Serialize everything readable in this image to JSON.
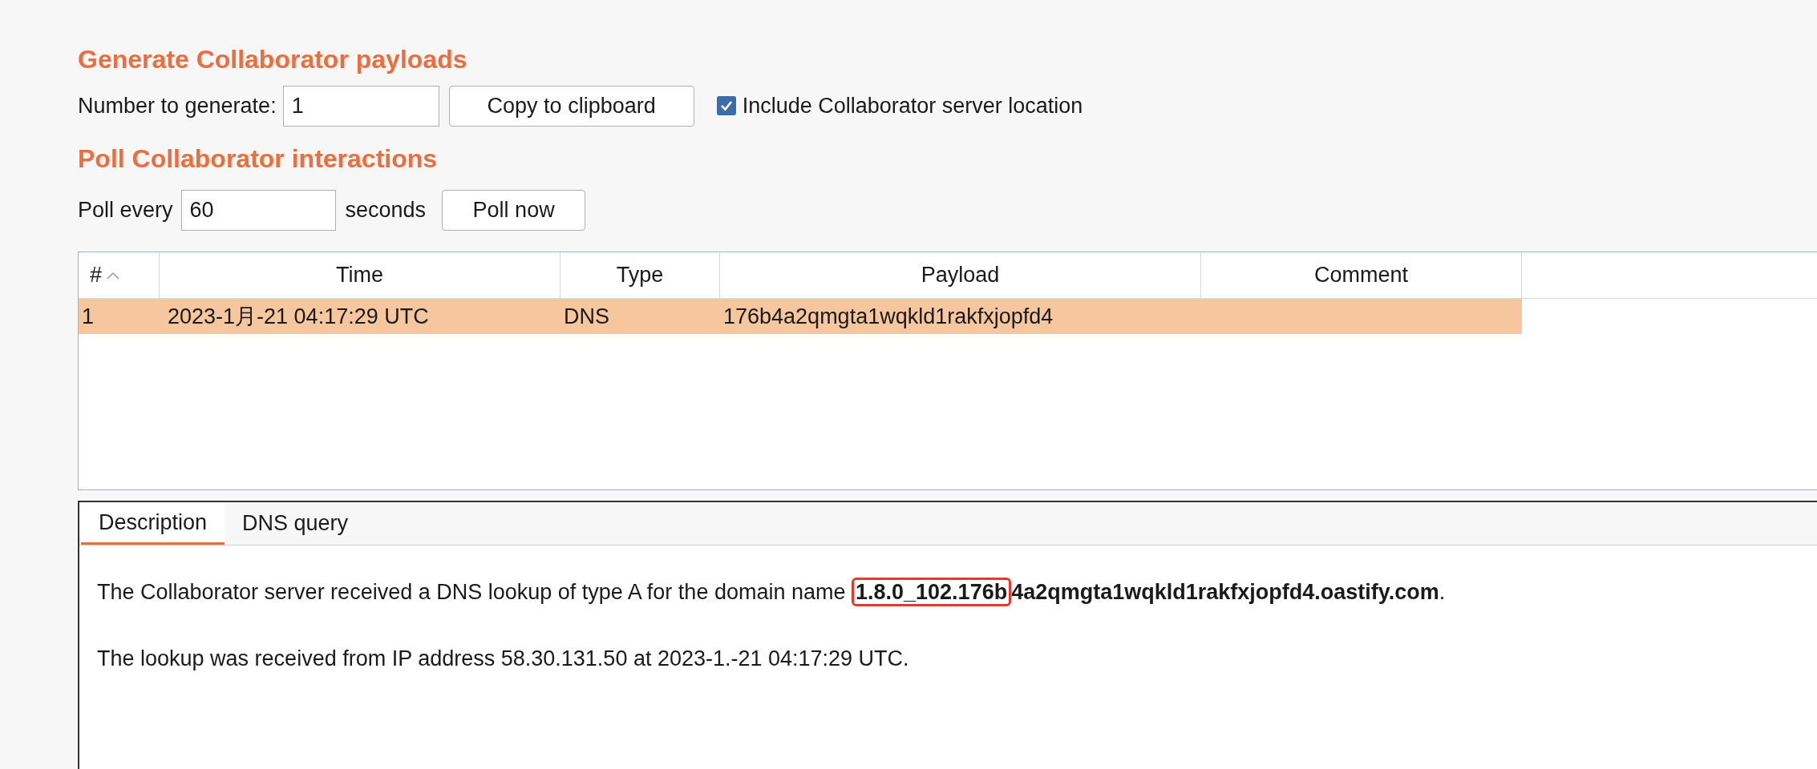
{
  "generate": {
    "heading": "Generate Collaborator payloads",
    "number_label": "Number to generate:",
    "number_value": "1",
    "copy_button": "Copy to clipboard",
    "include_location": {
      "label": "Include Collaborator server location",
      "checked": true
    }
  },
  "poll": {
    "heading": "Poll Collaborator interactions",
    "prefix": "Poll every",
    "interval_value": "60",
    "suffix": "seconds",
    "poll_button": "Poll now"
  },
  "table": {
    "columns": [
      {
        "label": "#",
        "sorted": true
      },
      {
        "label": "Time",
        "sorted": false
      },
      {
        "label": "Type",
        "sorted": false
      },
      {
        "label": "Payload",
        "sorted": false
      },
      {
        "label": "Comment",
        "sorted": false
      }
    ],
    "rows": [
      {
        "cells": [
          "1",
          "2023-1月-21 04:17:29 UTC",
          "DNS",
          "176b4a2qmgta1wqkld1rakfxjopfd4",
          ""
        ],
        "selected": true
      }
    ]
  },
  "details": {
    "tabs": [
      {
        "label": "Description",
        "selected": true
      },
      {
        "label": "DNS query",
        "selected": false
      }
    ],
    "lookup": {
      "prefix": "The Collaborator server received a DNS lookup of type A for the domain name ",
      "highlighted": "1.8.0_102.176b",
      "rest": "4a2qmgta1wqkld1rakfxjopfd4.oastify.com",
      "suffix": "."
    },
    "source": "The lookup was received from IP address 58.30.131.50 at 2023-1.-21 04:17:29 UTC."
  }
}
